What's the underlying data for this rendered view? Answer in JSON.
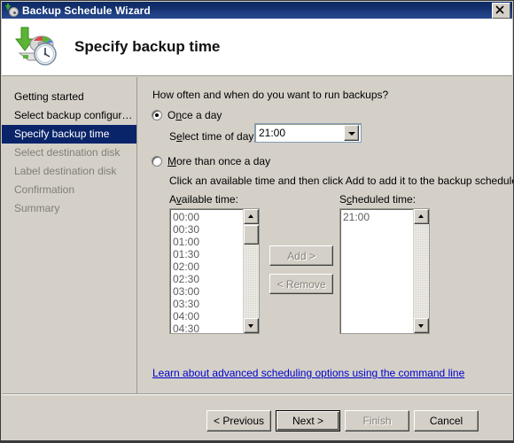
{
  "window": {
    "title": "Backup Schedule Wizard",
    "title_icon": "backup-clock-icon",
    "close_icon": "close-icon"
  },
  "header": {
    "title": "Specify backup time",
    "icon": "backup-disk-clock-icon"
  },
  "sidebar": {
    "items": [
      {
        "label": "Getting started",
        "state": "done"
      },
      {
        "label": "Select backup configur…",
        "state": "done"
      },
      {
        "label": "Specify backup time",
        "state": "current"
      },
      {
        "label": "Select destination disk",
        "state": "pending"
      },
      {
        "label": "Label destination disk",
        "state": "pending"
      },
      {
        "label": "Confirmation",
        "state": "pending"
      },
      {
        "label": "Summary",
        "state": "pending"
      }
    ]
  },
  "main": {
    "prompt": "How often and when do you want to run backups?",
    "radio_once": {
      "label_pre": "O",
      "label_accel": "n",
      "label_post": "ce a day",
      "checked": true
    },
    "time_of_day_label_pre": "S",
    "time_of_day_label_accel": "e",
    "time_of_day_label_post": "lect time of day:",
    "time_combo": {
      "value": "21:00",
      "arrow_icon": "chevron-down-icon"
    },
    "radio_more": {
      "label_pre": "",
      "label_accel": "M",
      "label_post": "ore than once a day",
      "checked": false
    },
    "hint": "Click an available time and then click Add to add it to the backup schedule.",
    "available_label_pre": "A",
    "available_label_accel": "v",
    "available_label_post": "ailable time:",
    "scheduled_label_pre": "S",
    "scheduled_label_accel": "c",
    "scheduled_label_post": "heduled time:",
    "available_times": [
      "00:00",
      "00:30",
      "01:00",
      "01:30",
      "02:00",
      "02:30",
      "03:00",
      "03:30",
      "04:00",
      "04:30"
    ],
    "scheduled_times": [
      "21:00"
    ],
    "add_button": {
      "label": "Add >",
      "accel": "A",
      "enabled": false
    },
    "remove_button": {
      "label": "< Remove",
      "accel": "R",
      "enabled": false
    },
    "link": "Learn about advanced scheduling options using the command line",
    "scrollbar_up_icon": "scroll-up-icon",
    "scrollbar_down_icon": "scroll-down-icon"
  },
  "footer": {
    "previous": {
      "label": "< Previous",
      "accel": "P",
      "enabled": true
    },
    "next": {
      "label": "Next >",
      "accel": "N",
      "enabled": true,
      "default": true
    },
    "finish": {
      "label": "Finish",
      "accel": "F",
      "enabled": false
    },
    "cancel": {
      "label": "Cancel",
      "enabled": true
    }
  },
  "colors": {
    "titlebar": "#15326f",
    "face": "#d4d0c8",
    "highlight": "#0a246a",
    "link": "#0000cd"
  }
}
